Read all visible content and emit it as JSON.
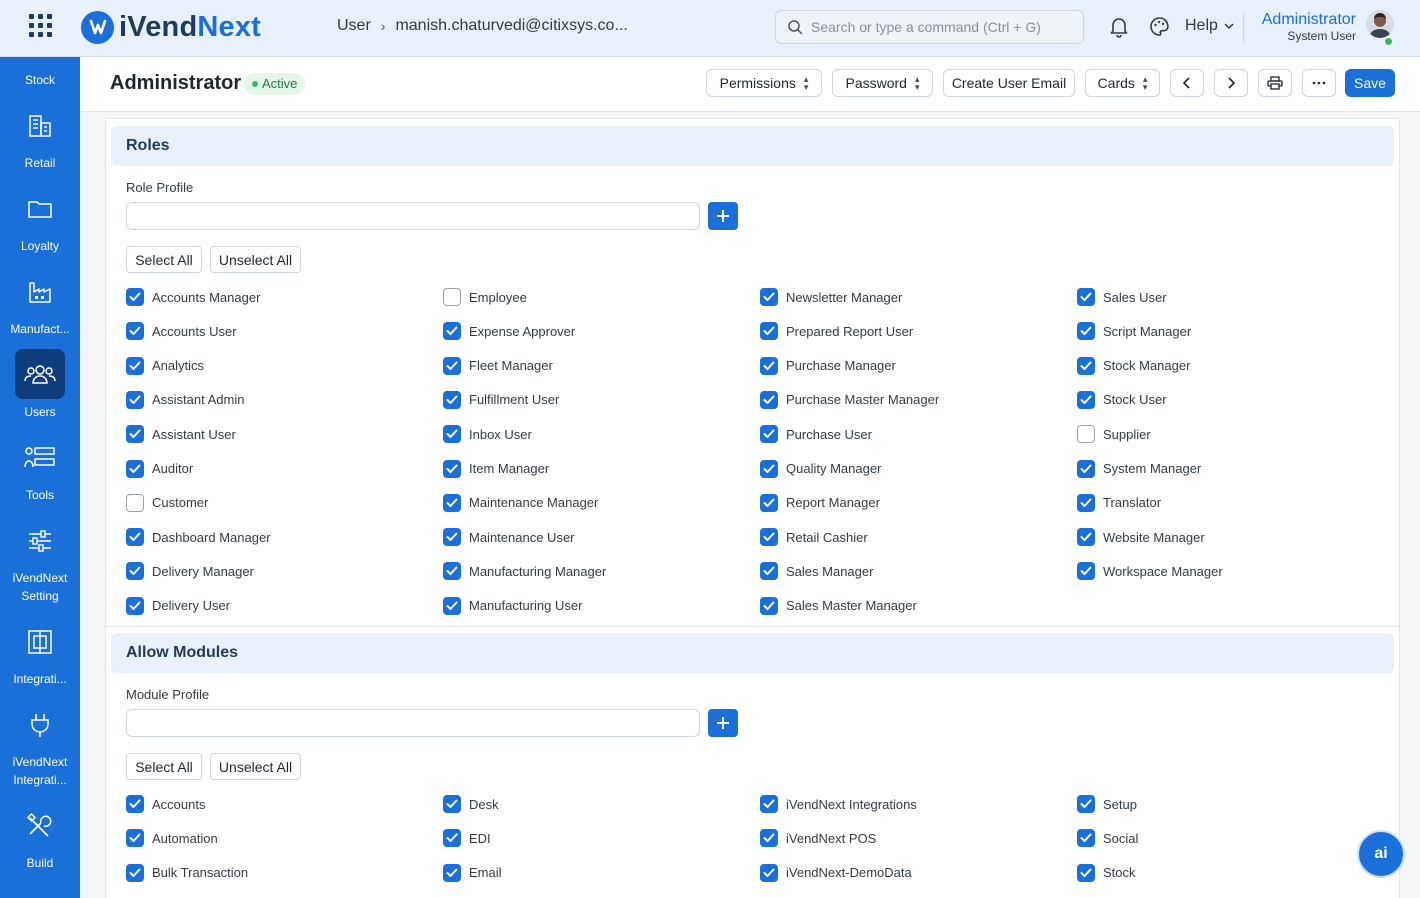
{
  "app": {
    "brand_a": "iVend",
    "brand_b": "Next"
  },
  "breadcrumb": {
    "root": "User",
    "current": "manish.chaturvedi@citixsys.co..."
  },
  "search": {
    "placeholder": "Search or type a command (Ctrl + G)"
  },
  "header": {
    "help_label": "Help",
    "user_name": "Administrator",
    "user_role": "System User"
  },
  "sidebar": {
    "items": [
      {
        "label": "Stock",
        "icon": "stock-icon"
      },
      {
        "label": "Retail",
        "icon": "retail-icon"
      },
      {
        "label": "Loyalty",
        "icon": "folder-icon"
      },
      {
        "label": "Manufact...",
        "icon": "factory-icon"
      },
      {
        "label": "Users",
        "icon": "users-icon"
      },
      {
        "label": "Tools",
        "icon": "tools-icon"
      },
      {
        "label": "iVendNext Setting",
        "icon": "sliders-icon"
      },
      {
        "label": "Integrati...",
        "icon": "integration-icon"
      },
      {
        "label": "iVendNext Integrati...",
        "icon": "plug-icon"
      },
      {
        "label": "Build",
        "icon": "build-icon"
      }
    ]
  },
  "page": {
    "title": "Administrator",
    "status": "Active",
    "buttons": {
      "permissions": "Permissions",
      "password": "Password",
      "create_email": "Create User Email",
      "cards": "Cards",
      "save": "Save"
    }
  },
  "roles": {
    "title": "Roles",
    "profile_label": "Role Profile",
    "profile_value": "",
    "select_all": "Select All",
    "unselect_all": "Unselect All",
    "columns": [
      [
        {
          "label": "Accounts Manager",
          "checked": true
        },
        {
          "label": "Accounts User",
          "checked": true
        },
        {
          "label": "Analytics",
          "checked": true
        },
        {
          "label": "Assistant Admin",
          "checked": true
        },
        {
          "label": "Assistant User",
          "checked": true
        },
        {
          "label": "Auditor",
          "checked": true
        },
        {
          "label": "Customer",
          "checked": false
        },
        {
          "label": "Dashboard Manager",
          "checked": true
        },
        {
          "label": "Delivery Manager",
          "checked": true
        },
        {
          "label": "Delivery User",
          "checked": true
        }
      ],
      [
        {
          "label": "Employee",
          "checked": false
        },
        {
          "label": "Expense Approver",
          "checked": true
        },
        {
          "label": "Fleet Manager",
          "checked": true
        },
        {
          "label": "Fulfillment User",
          "checked": true
        },
        {
          "label": "Inbox User",
          "checked": true
        },
        {
          "label": "Item Manager",
          "checked": true
        },
        {
          "label": "Maintenance Manager",
          "checked": true
        },
        {
          "label": "Maintenance User",
          "checked": true
        },
        {
          "label": "Manufacturing Manager",
          "checked": true
        },
        {
          "label": "Manufacturing User",
          "checked": true
        }
      ],
      [
        {
          "label": "Newsletter Manager",
          "checked": true
        },
        {
          "label": "Prepared Report User",
          "checked": true
        },
        {
          "label": "Purchase Manager",
          "checked": true
        },
        {
          "label": "Purchase Master Manager",
          "checked": true
        },
        {
          "label": "Purchase User",
          "checked": true
        },
        {
          "label": "Quality Manager",
          "checked": true
        },
        {
          "label": "Report Manager",
          "checked": true
        },
        {
          "label": "Retail Cashier",
          "checked": true
        },
        {
          "label": "Sales Manager",
          "checked": true
        },
        {
          "label": "Sales Master Manager",
          "checked": true
        }
      ],
      [
        {
          "label": "Sales User",
          "checked": true
        },
        {
          "label": "Script Manager",
          "checked": true
        },
        {
          "label": "Stock Manager",
          "checked": true
        },
        {
          "label": "Stock User",
          "checked": true
        },
        {
          "label": "Supplier",
          "checked": false
        },
        {
          "label": "System Manager",
          "checked": true
        },
        {
          "label": "Translator",
          "checked": true
        },
        {
          "label": "Website Manager",
          "checked": true
        },
        {
          "label": "Workspace Manager",
          "checked": true
        }
      ]
    ]
  },
  "modules": {
    "title": "Allow Modules",
    "profile_label": "Module Profile",
    "profile_value": "",
    "select_all": "Select All",
    "unselect_all": "Unselect All",
    "columns": [
      [
        {
          "label": "Accounts",
          "checked": true
        },
        {
          "label": "Automation",
          "checked": true
        },
        {
          "label": "Bulk Transaction",
          "checked": true
        }
      ],
      [
        {
          "label": "Desk",
          "checked": true
        },
        {
          "label": "EDI",
          "checked": true
        },
        {
          "label": "Email",
          "checked": true
        }
      ],
      [
        {
          "label": "iVendNext Integrations",
          "checked": true
        },
        {
          "label": "iVendNext POS",
          "checked": true
        },
        {
          "label": "iVendNext-DemoData",
          "checked": true
        }
      ],
      [
        {
          "label": "Setup",
          "checked": true
        },
        {
          "label": "Social",
          "checked": true
        },
        {
          "label": "Stock",
          "checked": true
        }
      ]
    ]
  },
  "assistant": {
    "label": "ai"
  },
  "colors": {
    "primary": "#1a6fd8",
    "sidebar_active": "#0d3d7a",
    "section_bg": "#e8f1fa",
    "success": "#2ebd59"
  }
}
